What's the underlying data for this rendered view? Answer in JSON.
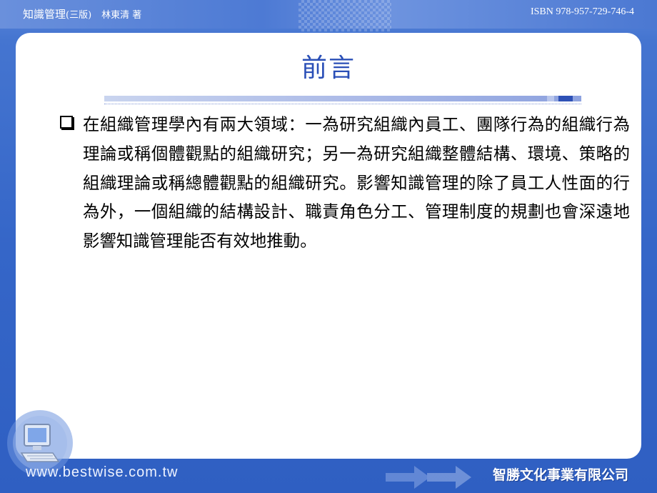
{
  "header": {
    "book_title": "知識管理",
    "edition": "(三版)",
    "author": "林東清 著",
    "isbn": "ISBN 978-957-729-746-4"
  },
  "slide": {
    "title": "前言",
    "bullet_text": "在組織管理學內有兩大領域：一為研究組織內員工、團隊行為的組織行為理論或稱個體觀點的組織研究；另一為研究組織整體結構、環境、策略的組織理論或稱總體觀點的組織研究。影響知識管理的除了員工人性面的行為外，一個組織的結構設計、職責角色分工、管理制度的規劃也會深遠地影響知識管理能否有效地推動。"
  },
  "footer": {
    "url": "www.bestwise.com.tw",
    "company": "智勝文化事業有限公司"
  },
  "icons": {
    "bullet": "checkbox-square-icon",
    "computer": "computer-icon",
    "arrows": "arrow-right-icon"
  },
  "colors": {
    "background": "#3566c8",
    "title": "#2a4fb7",
    "panel": "#ffffff"
  }
}
